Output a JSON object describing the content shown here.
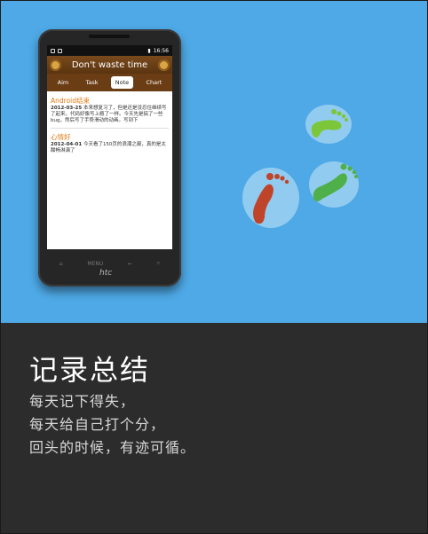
{
  "phone": {
    "brand": "htc",
    "statusbar": {
      "time": "16:56"
    },
    "app_title": "Don't waste time",
    "tabs": [
      "Aim",
      "Task",
      "Note",
      "Chart"
    ],
    "active_tab": "Note",
    "notes": [
      {
        "title": "Android结束",
        "date": "2012-03-25",
        "body": "本来想复习了，但是还是没忍住继续写了起来。代码好像写上瘾了一样。今天先是搞了一些bug，然后写了手势滑动的动画。写到下"
      },
      {
        "title": "心情好",
        "date": "2012-04-01",
        "body": "今天看了150页的浪潮之巅，真的是太酣畅淋漓了"
      }
    ],
    "nav_buttons": [
      "⌂",
      "MENU",
      "←",
      "⌕"
    ]
  },
  "colors": {
    "top_bg": "#4ea9e6",
    "bottom_bg": "#2c2c2c",
    "accent_orange": "#e07a12",
    "title_brown": "#6b3d14",
    "footprint_green": "#7cc63a",
    "footprint_red": "#c0442a"
  },
  "headline": "记录总结",
  "lines": [
    "每天记下得失，",
    "每天给自己打个分，",
    "回头的时候，有迹可循。"
  ]
}
